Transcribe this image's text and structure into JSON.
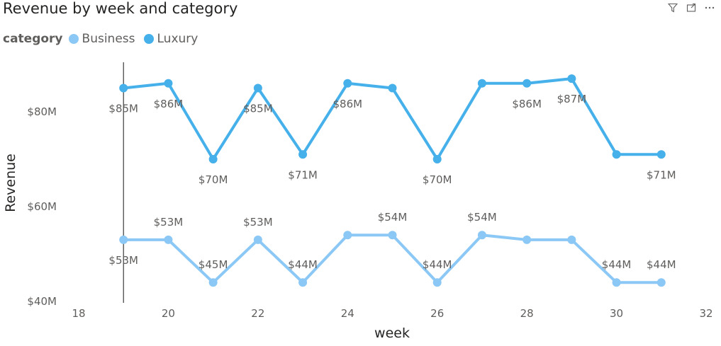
{
  "header": {
    "title": "Revenue by week and category",
    "icons": [
      "filter-icon",
      "focus-mode-icon",
      "more-options-icon"
    ]
  },
  "legend": {
    "label": "category",
    "items": [
      {
        "name": "Business",
        "color": "#8cc8f5"
      },
      {
        "name": "Luxury",
        "color": "#45b0ea"
      }
    ]
  },
  "chart_data": {
    "type": "line",
    "title": "Revenue by week and category",
    "xlabel": "week",
    "ylabel": "Revenue",
    "x": [
      19,
      20,
      21,
      22,
      23,
      24,
      25,
      26,
      27,
      28,
      29,
      30,
      31
    ],
    "xlim": [
      18,
      32
    ],
    "ylim": [
      40,
      90
    ],
    "x_ticks": [
      18,
      20,
      22,
      24,
      26,
      28,
      30,
      32
    ],
    "y_ticks": [
      {
        "value": 40,
        "label": "$40M"
      },
      {
        "value": 60,
        "label": "$60M"
      },
      {
        "value": 80,
        "label": "$80M"
      }
    ],
    "legend_position": "top-left",
    "grid": false,
    "reference_line_x": 19,
    "series": [
      {
        "name": "Luxury",
        "color": "#45b0ea",
        "values": [
          85,
          86,
          70,
          85,
          71,
          86,
          85,
          70,
          86,
          86,
          87,
          71,
          71
        ],
        "labels": [
          "$85M",
          "$86M",
          "$70M",
          "$85M",
          "$71M",
          "$86M",
          "",
          "$70M",
          "",
          "$86M",
          "$87M",
          "",
          "$71M"
        ],
        "label_pos": [
          "below",
          "below",
          "below",
          "below",
          "below",
          "below",
          "",
          "below",
          "",
          "below",
          "below",
          "",
          "below"
        ]
      },
      {
        "name": "Business",
        "color": "#8cc8f5",
        "values": [
          53,
          53,
          44,
          53,
          44,
          54,
          54,
          44,
          54,
          53,
          53,
          44,
          44
        ],
        "labels": [
          "$53M",
          "$53M",
          "$45M",
          "$53M",
          "$44M",
          "",
          "$54M",
          "$44M",
          "$54M",
          "",
          "",
          "$44M",
          "$44M"
        ],
        "label_pos": [
          "below",
          "above",
          "above",
          "above",
          "above",
          "",
          "above",
          "above",
          "above",
          "",
          "",
          "above",
          "above"
        ]
      }
    ]
  }
}
